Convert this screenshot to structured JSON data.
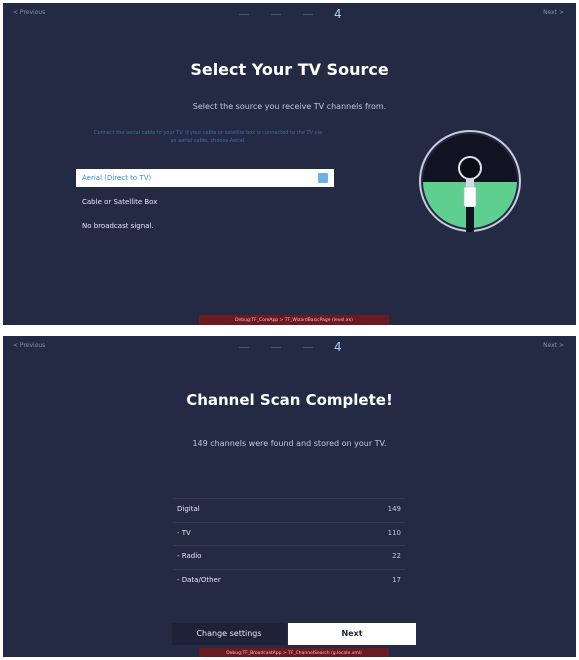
{
  "screen1": {
    "previous_label": "< Previous",
    "next_label": "Next >",
    "step": "4",
    "title": "Select Your TV Source",
    "subtitle": "Select the source you receive TV channels from.",
    "hint_line1": "Connect the aerial cable to your TV. If your cable or satellite box is connected to the TV via",
    "hint_line2": "an aerial cable, choose Aerial.",
    "options": [
      {
        "label": "Aerial (Direct to TV)",
        "selected": true
      },
      {
        "label": "Cable or Satellite Box",
        "selected": false
      },
      {
        "label": "No broadcast signal.",
        "selected": false
      }
    ],
    "debug": "Debug:TF_CoreApp > TF_WizardBasicPage (level.xx)"
  },
  "screen2": {
    "previous_label": "< Previous",
    "next_label": "Next >",
    "step": "4",
    "title": "Channel Scan Complete!",
    "subtitle": "149 channels were found and stored on your TV.",
    "rows": [
      {
        "label": "Digital",
        "value": "149"
      },
      {
        "label": "- TV",
        "value": "110"
      },
      {
        "label": "- Radio",
        "value": "22"
      },
      {
        "label": "- Data/Other",
        "value": "17"
      }
    ],
    "change_settings_label": "Change settings",
    "next_button_label": "Next",
    "debug": "Debug:TF_BroadcastApp > TF_ChannelSearch (g.locale.xml)"
  },
  "colors": {
    "background": "#252a44",
    "accent_blue": "#3a8fd9",
    "illustration_green": "#5fcf8f",
    "debug_red": "#6b1a22"
  }
}
